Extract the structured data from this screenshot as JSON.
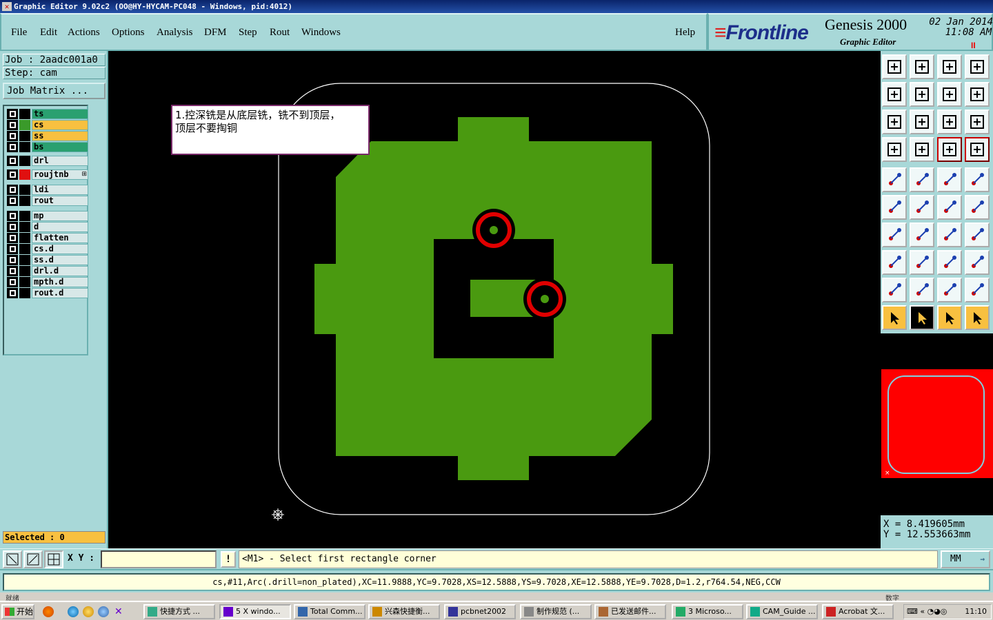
{
  "window": {
    "title": "Graphic Editor 9.02c2  (OO@HY-HYCAM-PC048 - Windows, pid:4012)"
  },
  "menu": [
    "File",
    "Edit",
    "Actions",
    "Options",
    "Analysis",
    "DFM",
    "Step",
    "Rout",
    "Windows"
  ],
  "help_label": "Help",
  "brand": {
    "logo": "Frontline",
    "product": "Genesis 2000",
    "subtitle": "Graphic Editor",
    "date": "02 Jan 2014",
    "time": "11:08 AM",
    "pause": "II"
  },
  "job": {
    "job_label": "Job : 2aadc001a0",
    "step_label": "Step: cam",
    "matrix_button": "Job Matrix ..."
  },
  "layers": [
    {
      "name": "ts",
      "color": "#2aa070",
      "swatch": "#000000"
    },
    {
      "name": "cs",
      "color": "#f8c040",
      "swatch": "#3a9a2a"
    },
    {
      "name": "ss",
      "color": "#f8c040",
      "swatch": "#000000"
    },
    {
      "name": "bs",
      "color": "#2aa070",
      "swatch": "#000000"
    },
    {
      "name": "drl",
      "color": "#d8e8e8",
      "swatch": "#000000"
    },
    {
      "name": "roujtnb",
      "color": "#d8e8e8",
      "swatch": "#e01010",
      "suffix": "⊞"
    },
    {
      "name": "ldi",
      "color": "#d8e8e8",
      "swatch": "#000000"
    },
    {
      "name": "rout",
      "color": "#d8e8e8",
      "swatch": "#000000"
    },
    {
      "name": "mp",
      "color": "#d8e8e8",
      "swatch": "#000000"
    },
    {
      "name": "d",
      "color": "#d8e8e8",
      "swatch": "#000000"
    },
    {
      "name": "flatten",
      "color": "#d8e8e8",
      "swatch": "#000000"
    },
    {
      "name": "cs.d",
      "color": "#d8e8e8",
      "swatch": "#000000"
    },
    {
      "name": "ss.d",
      "color": "#d8e8e8",
      "swatch": "#000000"
    },
    {
      "name": "drl.d",
      "color": "#d8e8e8",
      "swatch": "#000000"
    },
    {
      "name": "mpth.d",
      "color": "#d8e8e8",
      "swatch": "#000000"
    },
    {
      "name": "rout.d",
      "color": "#d8e8e8",
      "swatch": "#000000"
    }
  ],
  "selected_label": "Selected : 0",
  "annotation": {
    "line1": "1.控深铣是从底层铣，铣不到顶层，",
    "line2": "顶层不要掏铜"
  },
  "coords": {
    "x": "X  =  8.419605mm",
    "y": "Y  =  12.553663mm"
  },
  "command": {
    "xy_label": "X Y :",
    "input_value": "",
    "prompt_button": "!",
    "prompt": "<M1> - Select first rectangle corner",
    "units": "MM"
  },
  "status_text": "cs,#11,Arc(.drill=non_plated),XC=11.9888,YC=9.7028,XS=12.5888,YS=9.7028,XE=12.5888,YE=9.7028,D=1.2,r764.54,NEG,CCW",
  "hint": {
    "left": "就绪",
    "right": "数字"
  },
  "taskbar": {
    "start": "开始",
    "tasks": [
      "快捷方式 ...",
      "5 X windo...",
      "Total Comm...",
      "兴森快捷衡...",
      "pcbnet2002",
      "制作规范 (...",
      "已发送邮件...",
      "3 Microso...",
      "CAM_Guide ...",
      "Acrobat 文..."
    ],
    "clock": "11:10"
  },
  "colors": {
    "copper": "#4a9a10",
    "drill_ring": "#e00000",
    "panel": "#a8d8d8",
    "outline": "#ffffff"
  }
}
